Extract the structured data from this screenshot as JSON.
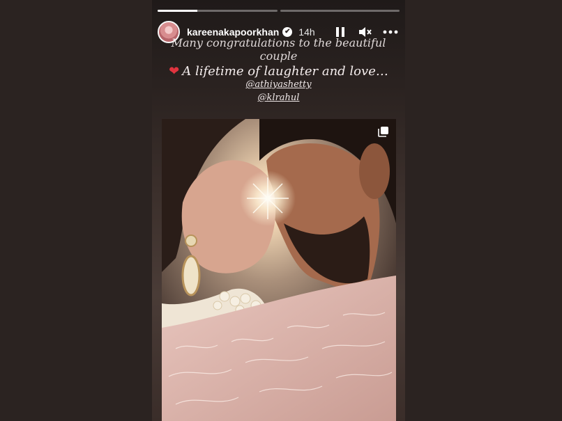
{
  "story": {
    "username": "kareenakapoorkhan",
    "verified_label": "✔",
    "time_ago": "14h",
    "progress": [
      0.33,
      0
    ],
    "caption_line1": "Many congratulations to the beautiful couple",
    "caption_heart": "❤",
    "caption_line2": "A lifetime of laughter and love…",
    "mentions": [
      "@athiyashetty",
      "@klrahul"
    ]
  },
  "icons": {
    "pause": "pause-icon",
    "mute": "speaker-muted-icon",
    "more": "more-options-icon",
    "multi": "multiple-images-icon"
  },
  "colors": {
    "background": "#2b2321",
    "heart": "#e0343f"
  }
}
